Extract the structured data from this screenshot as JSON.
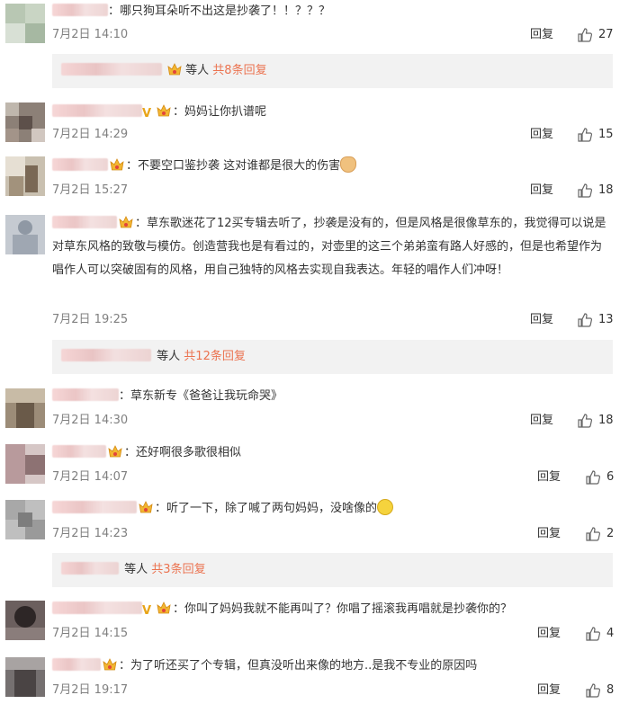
{
  "ui": {
    "reply_label": "回复",
    "others_label": "等人",
    "colon": "："
  },
  "comments": [
    {
      "text": "哪只狗耳朵听不出这是抄袭了！！？？？",
      "date": "7月2日 14:10",
      "likes": "27",
      "reply_summary": "共8条回复"
    },
    {
      "text": "妈妈让你扒谱呢",
      "date": "7月2日 14:29",
      "likes": "15"
    },
    {
      "text": "不要空口鉴抄袭 这对谁都是很大的伤害",
      "date": "7月2日 15:27",
      "likes": "18"
    },
    {
      "text": "草东歌迷花了12买专辑去听了，抄袭是没有的，但是风格是很像草东的，我觉得可以说是对草东风格的致敬与模仿。创造营我也是有看过的，对壶里的这三个弟弟蛮有路人好感的，但是也希望作为唱作人可以突破固有的风格，用自己独特的风格去实现自我表达。年轻的唱作人们冲呀！",
      "date": "7月2日 19:25",
      "likes": "13",
      "reply_summary": "共12条回复"
    },
    {
      "text": "草东新专《爸爸让我玩命哭》",
      "date": "7月2日 14:30",
      "likes": "18"
    },
    {
      "text": "还好啊很多歌很相似",
      "date": "7月2日 14:07",
      "likes": "6"
    },
    {
      "text": "听了一下，除了喊了两句妈妈，没啥像的",
      "date": "7月2日 14:23",
      "likes": "2",
      "reply_summary": "共3条回复"
    },
    {
      "text": "你叫了妈妈我就不能再叫了？你唱了摇滚我再唱就是抄袭你的？",
      "date": "7月2日 14:15",
      "likes": "4"
    },
    {
      "text": "为了听还买了个专辑，但真没听出来像的地方..是我不专业的原因吗",
      "date": "7月2日 19:17",
      "likes": "8"
    }
  ]
}
